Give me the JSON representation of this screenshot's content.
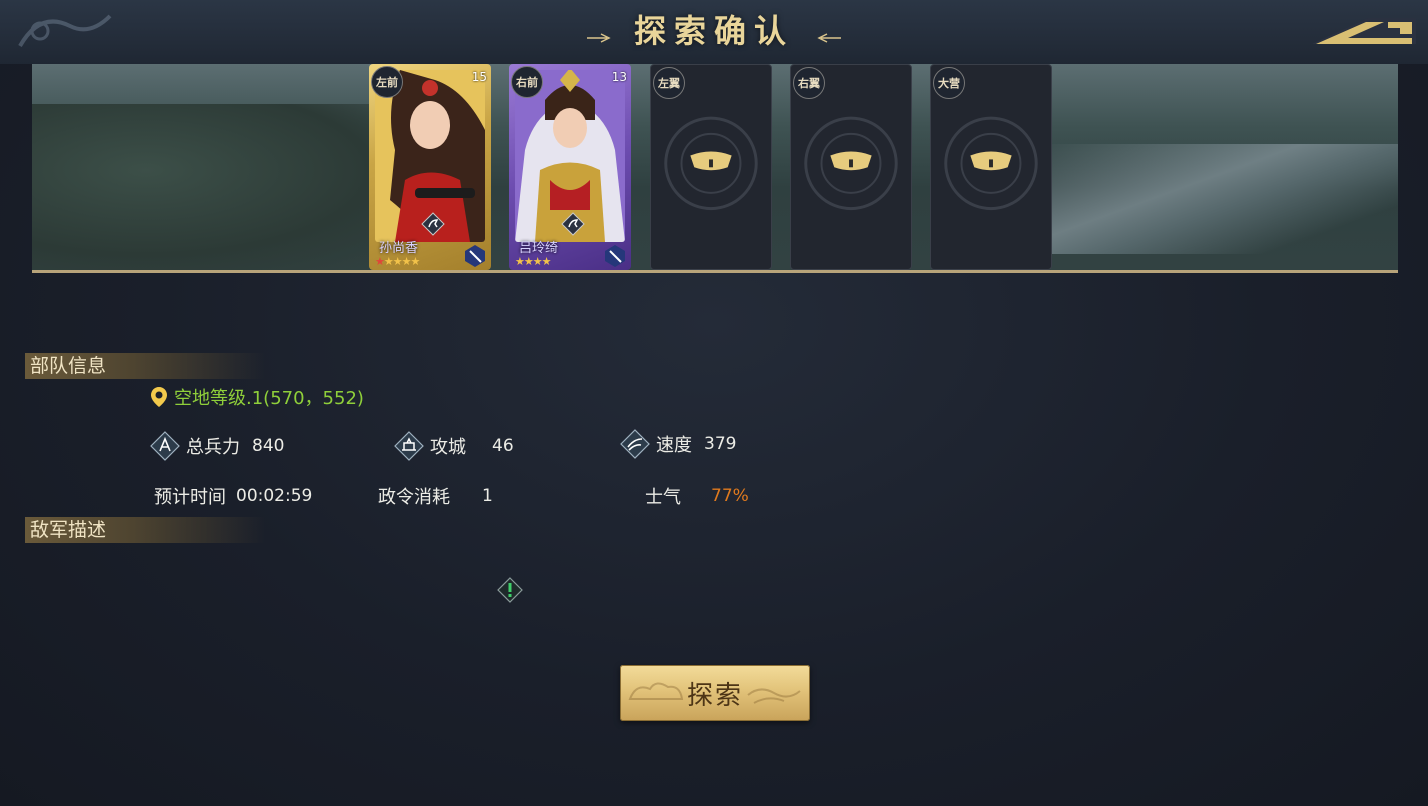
{
  "header": {
    "title": "探索确认"
  },
  "formation": {
    "slots": [
      {
        "position": "左前",
        "name": "孙尚香",
        "level": "15",
        "stars": 5,
        "red_stars": 1,
        "rarity_color": "#d4b14c",
        "filled": true
      },
      {
        "position": "右前",
        "name": "吕玲绮",
        "level": "13",
        "stars": 4,
        "red_stars": 0,
        "rarity_color": "#7d5bc4",
        "filled": true
      },
      {
        "position": "左翼",
        "filled": false
      },
      {
        "position": "右翼",
        "filled": false
      },
      {
        "position": "大营",
        "filled": false
      }
    ]
  },
  "troop_info": {
    "header": "部队信息",
    "location": "空地等级.1(570，552)",
    "total_troops_label": "总兵力",
    "total_troops_value": "840",
    "siege_label": "攻城",
    "siege_value": "46",
    "speed_label": "速度",
    "speed_value": "379",
    "eta_label": "预计时间",
    "eta_value": "00:02:59",
    "order_cost_label": "政令消耗",
    "order_cost_value": "1",
    "morale_label": "士气",
    "morale_value": "77%"
  },
  "enemy_info": {
    "header": "敌军描述"
  },
  "actions": {
    "explore_label": "探索"
  },
  "colors": {
    "accent_gold": "#e9d59a",
    "location_green": "#8fcf3a",
    "morale_orange": "#e07a1e"
  },
  "icons": [
    "back-arrow-icon",
    "location-pin-icon",
    "troops-icon",
    "siege-icon",
    "speed-icon",
    "warning-icon",
    "lock-icon"
  ]
}
